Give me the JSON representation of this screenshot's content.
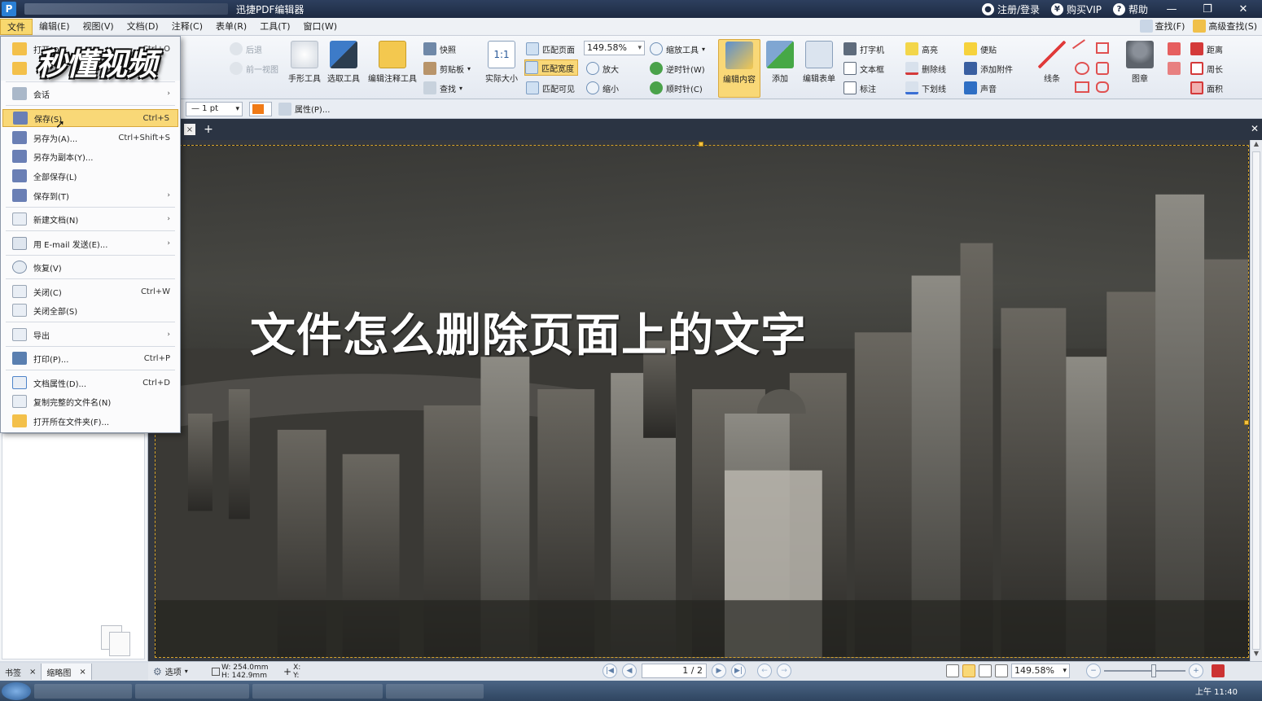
{
  "window": {
    "title": "迅捷PDF编辑器",
    "account": "注册/登录",
    "vip": "购买VIP",
    "help": "帮助"
  },
  "menubar": {
    "items": [
      "文件",
      "编辑(E)",
      "视图(V)",
      "文档(D)",
      "注释(C)",
      "表单(R)",
      "工具(T)",
      "窗口(W)"
    ],
    "find": "查找(F)",
    "advanced_find": "高级查找(S)"
  },
  "ribbon": {
    "back": "后退",
    "prev_view": "前一视图",
    "hand_tool": "手形工具",
    "select_tool": "选取工具",
    "edit_annot_tool": "编辑注释工具",
    "snapshot": "快照",
    "clipboard": "剪贴板",
    "find": "查找",
    "actual_size": "实际大小",
    "fit_page": "匹配页面",
    "fit_width": "匹配宽度",
    "fit_visible": "匹配可见",
    "zoom_value": "149.58%",
    "zoom_tool": "缩放工具",
    "zoom_in": "放大",
    "zoom_out": "缩小",
    "rotate_ccw": "逆时针(W)",
    "rotate_cw": "顺时针(C)",
    "edit_content": "编辑内容",
    "add": "添加",
    "edit_form": "编辑表单",
    "typewriter": "打字机",
    "textbox": "文本框",
    "callout": "标注",
    "highlight": "高亮",
    "strikeout": "删除线",
    "underline": "下划线",
    "note": "便贴",
    "attach": "添加附件",
    "sound": "声音",
    "line": "线条",
    "stamp": "图章",
    "distance": "距离",
    "perimeter": "周长",
    "area": "面积"
  },
  "subbar": {
    "line_width": "— 1 pt",
    "properties": "属性(P)..."
  },
  "file_menu": {
    "items": [
      {
        "label": "打开(O)...",
        "shortcut": "Ctrl+O",
        "arrow": ""
      },
      {
        "label": "会话",
        "shortcut": "",
        "arrow": "›"
      },
      {
        "label": "保存(S)",
        "shortcut": "Ctrl+S",
        "arrow": ""
      },
      {
        "label": "另存为(A)...",
        "shortcut": "Ctrl+Shift+S",
        "arrow": ""
      },
      {
        "label": "另存为副本(Y)...",
        "shortcut": "",
        "arrow": ""
      },
      {
        "label": "全部保存(L)",
        "shortcut": "",
        "arrow": ""
      },
      {
        "label": "保存到(T)",
        "shortcut": "",
        "arrow": "›"
      },
      {
        "label": "新建文档(N)",
        "shortcut": "",
        "arrow": "›"
      },
      {
        "label": "用 E-mail 发送(E)...",
        "shortcut": "",
        "arrow": "›"
      },
      {
        "label": "恢复(V)",
        "shortcut": "",
        "arrow": ""
      },
      {
        "label": "关闭(C)",
        "shortcut": "Ctrl+W",
        "arrow": ""
      },
      {
        "label": "关闭全部(S)",
        "shortcut": "",
        "arrow": ""
      },
      {
        "label": "导出",
        "shortcut": "",
        "arrow": "›"
      },
      {
        "label": "打印(P)...",
        "shortcut": "Ctrl+P",
        "arrow": ""
      },
      {
        "label": "文档属性(D)...",
        "shortcut": "Ctrl+D",
        "arrow": ""
      },
      {
        "label": "复制完整的文件名(N)",
        "shortcut": "",
        "arrow": ""
      },
      {
        "label": "打开所在文件夹(F)...",
        "shortcut": "",
        "arrow": ""
      }
    ]
  },
  "document": {
    "headline": "文件怎么删除页面上的文字"
  },
  "sidebar": {
    "tab_bookmarks": "书签",
    "tab_thumbnails": "缩略图"
  },
  "statusbar": {
    "options": "选项",
    "width": "W: 254.0mm",
    "height": "H: 142.9mm",
    "x": "X:",
    "y": "Y:",
    "page": "1 / 2",
    "zoom": "149.58%"
  },
  "taskbar": {
    "clock": "上午 11:40"
  },
  "watermark": "秒懂视频",
  "colors": {
    "accent": "#f9d877",
    "title_bar": "#1d2a42",
    "line_color": "#f07a16"
  }
}
